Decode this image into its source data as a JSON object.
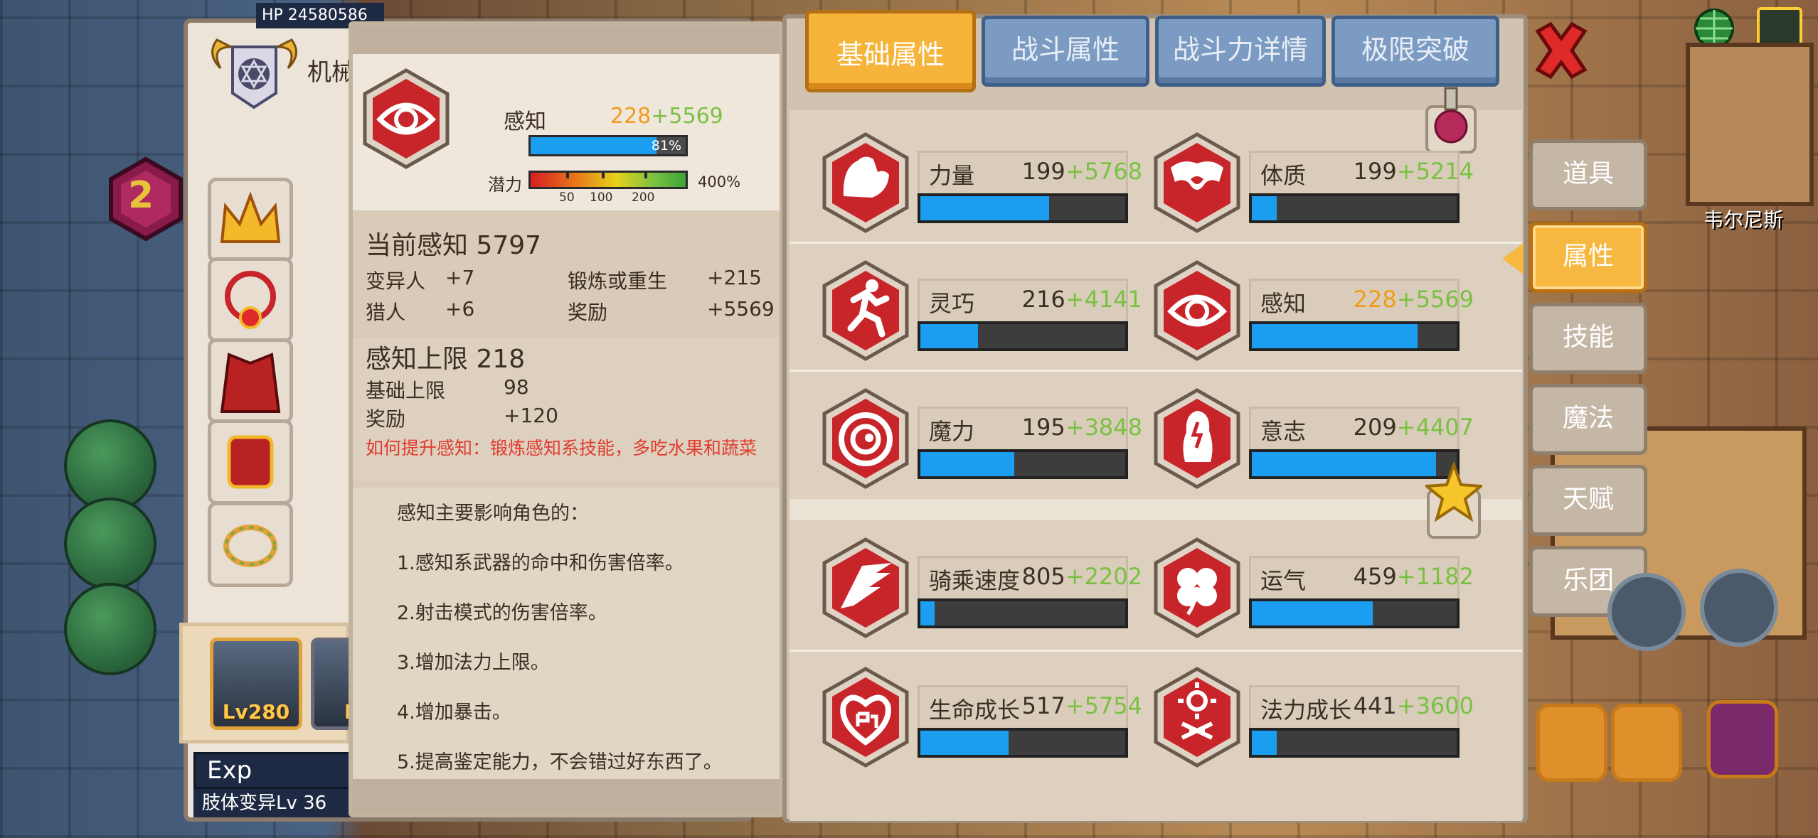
{
  "left_panel": {
    "hp_text": "HP 24580586",
    "char_name": "机械",
    "level_badge": "2",
    "hero_levels": [
      "Lv280",
      "Lv"
    ],
    "exp_label": "Exp",
    "mutation_label": "肢体变异Lv 36"
  },
  "tooltip": {
    "stat_name": "感知",
    "stat_base": "228",
    "stat_bonus": "+5569",
    "bar_percent": 81,
    "bar_percent_text": "81%",
    "potential_label": "潜力",
    "potential_max": "400%",
    "potential_ticks": [
      "50",
      "100",
      "200"
    ],
    "current_title": "当前感知 5797",
    "sources": [
      {
        "label": "变异人",
        "value": "+7"
      },
      {
        "label": "锻炼或重生",
        "value": "+215"
      },
      {
        "label": "猎人",
        "value": "+6"
      },
      {
        "label": "奖励",
        "value": "+5569"
      }
    ],
    "limit_title": "感知上限 218",
    "limit_rows": [
      {
        "label": "基础上限",
        "value": "98"
      },
      {
        "label": "奖励",
        "value": "+120"
      }
    ],
    "hint": "如何提升感知：锻炼感知系技能，多吃水果和蔬菜",
    "desc_title": "感知主要影响角色的：",
    "desc_lines": [
      "1.感知系武器的命中和伤害倍率。",
      "2.射击模式的伤害倍率。",
      "3.增加法力上限。",
      "4.增加暴击。",
      "5.提高鉴定能力，不会错过好东西了。"
    ]
  },
  "tabs": [
    "基础属性",
    "战斗属性",
    "战斗力详情",
    "极限突破"
  ],
  "active_tab": 0,
  "attributes": [
    {
      "label": "力量",
      "base": "199",
      "bonus": "+5768",
      "fill": 0.63,
      "icon": "strength-icon",
      "base_color": "#3b2f25"
    },
    {
      "label": "体质",
      "base": "199",
      "bonus": "+5214",
      "fill": 0.12,
      "icon": "constitution-icon",
      "base_color": "#3b2f25"
    },
    {
      "label": "灵巧",
      "base": "216",
      "bonus": "+4141",
      "fill": 0.28,
      "icon": "agility-icon",
      "base_color": "#3b2f25"
    },
    {
      "label": "感知",
      "base": "228",
      "bonus": "+5569",
      "fill": 0.81,
      "icon": "perception-icon",
      "base_color": "#f29b1a"
    },
    {
      "label": "魔力",
      "base": "195",
      "bonus": "+3848",
      "fill": 0.46,
      "icon": "magic-icon",
      "base_color": "#3b2f25"
    },
    {
      "label": "意志",
      "base": "209",
      "bonus": "+4407",
      "fill": 0.9,
      "icon": "will-icon",
      "base_color": "#3b2f25"
    },
    {
      "label": "骑乘速度",
      "base": "805",
      "bonus": "+2202",
      "fill": 0.07,
      "icon": "riding-icon",
      "base_color": "#3b2f25"
    },
    {
      "label": "运气",
      "base": "459",
      "bonus": "+1182",
      "fill": 0.59,
      "icon": "luck-icon",
      "base_color": "#3b2f25"
    },
    {
      "label": "生命成长",
      "base": "517",
      "bonus": "+5754",
      "fill": 0.43,
      "icon": "life-growth-icon",
      "base_color": "#3b2f25"
    },
    {
      "label": "法力成长",
      "base": "441",
      "bonus": "+3600",
      "fill": 0.12,
      "icon": "mana-growth-icon",
      "base_color": "#3b2f25"
    }
  ],
  "side_menu": [
    "道具",
    "属性",
    "技能",
    "魔法",
    "天赋",
    "乐团"
  ],
  "active_side": 1,
  "map": {
    "town_name": "韦尔尼斯"
  },
  "colors": {
    "accent_orange": "#f6b43a",
    "tab_blue": "#7c9bc2",
    "bar_blue": "#1b9ef0",
    "bonus_green": "#7ac143",
    "icon_red": "#c8252a",
    "hint_red": "#e23a2e"
  }
}
